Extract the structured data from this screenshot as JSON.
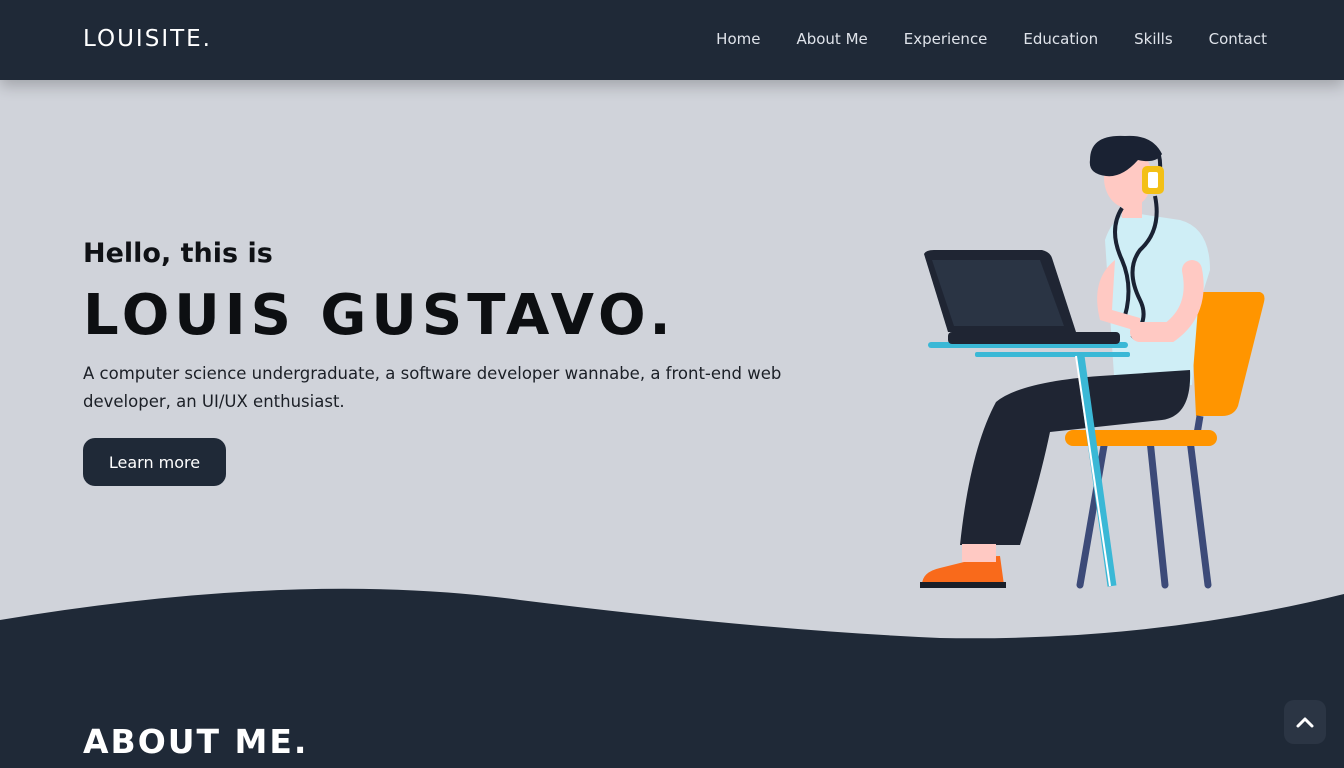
{
  "brand": "LOUISITE.",
  "nav": {
    "home": "Home",
    "about": "About Me",
    "experience": "Experience",
    "education": "Education",
    "skills": "Skills",
    "contact": "Contact"
  },
  "hero": {
    "greeting": "Hello, this is",
    "name": "LOUIS GUSTAVO.",
    "description": "A computer science undergraduate, a software developer wannabe, a front-end web developer, an UI/UX enthusiast.",
    "button_label": "Learn more"
  },
  "about": {
    "title": "ABOUT ME."
  },
  "icons": {
    "scroll_top": "chevron-up-icon"
  },
  "colors": {
    "navbar": "#1f2937",
    "hero_bg": "#d0d3da",
    "accent_orange": "#ff9500",
    "accent_cyan": "#3ab8d6"
  }
}
